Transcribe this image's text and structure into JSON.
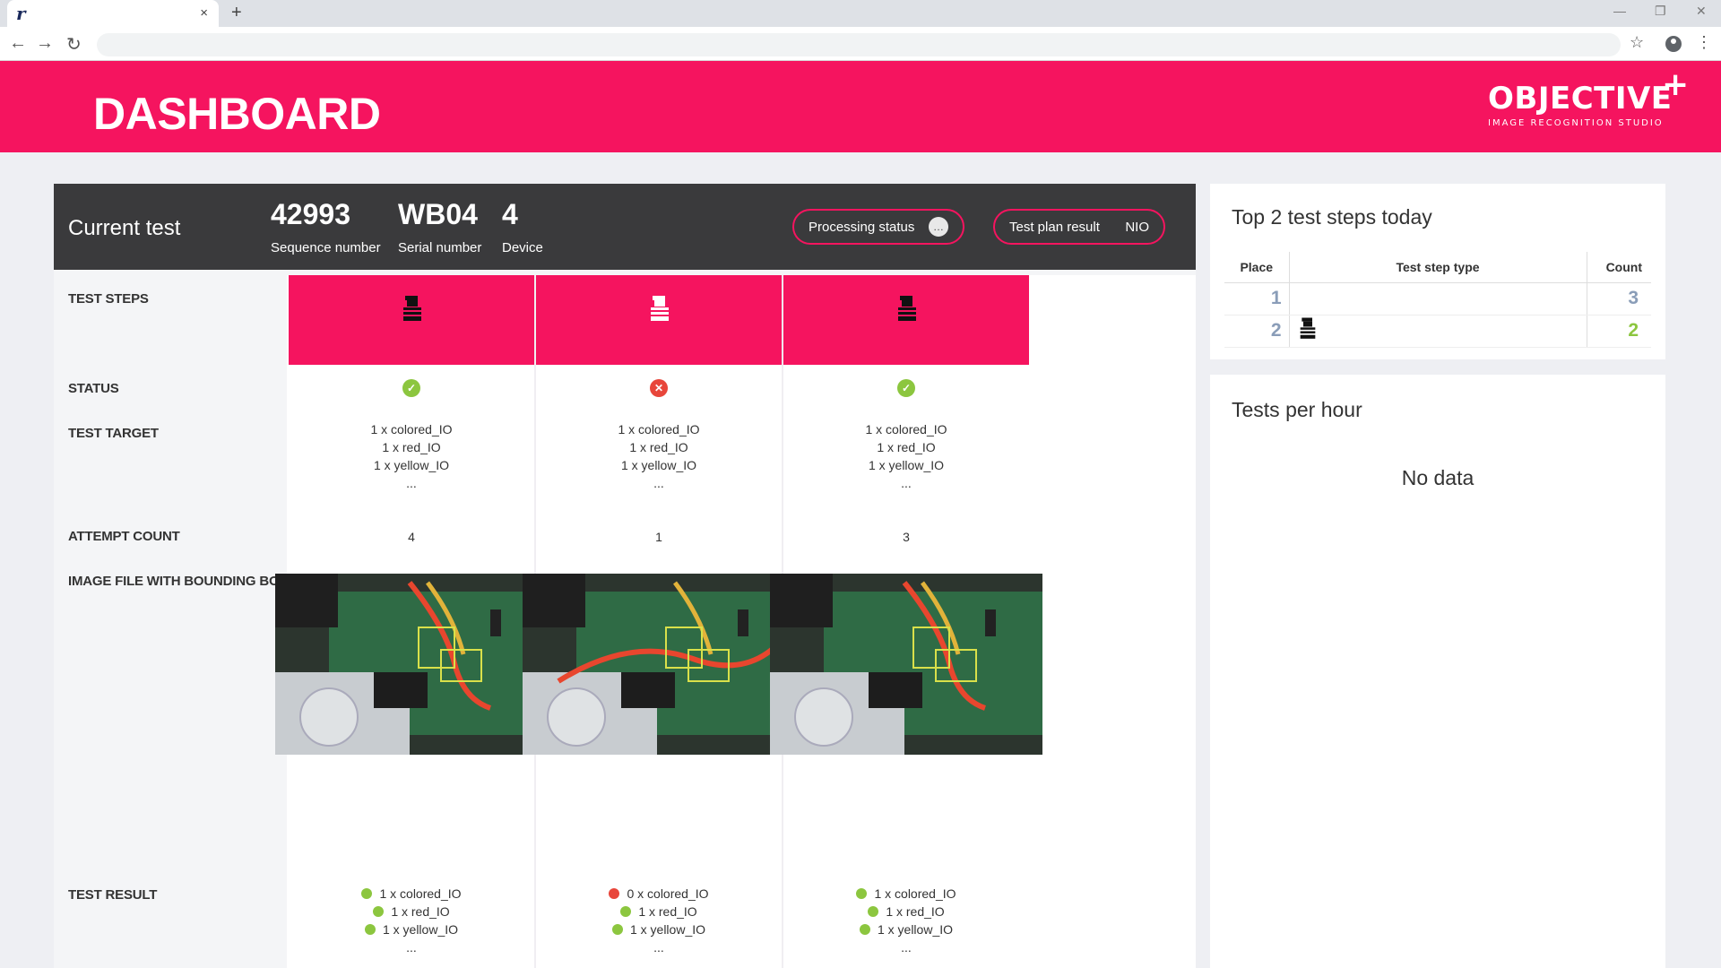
{
  "browser": {
    "tab_logo": "r",
    "tab_close": "×",
    "new_tab": "+",
    "back": "←",
    "forward": "→",
    "reload": "↻",
    "bookmark": "☆",
    "menu": "⋮",
    "minimize": "—",
    "restore": "❐",
    "close": "✕"
  },
  "header": {
    "title": "DASHBOARD",
    "brand_name": "OBJECTIVE",
    "brand_plus": "+",
    "brand_sub": "IMAGE RECOGNITION STUDIO",
    "accent_color": "#f5145f"
  },
  "current_test": {
    "label": "Current test",
    "sequence_number": "42993",
    "sequence_label": "Sequence number",
    "serial_number": "WB04",
    "serial_label": "Serial number",
    "device": "4",
    "device_label": "Device",
    "processing_status_label": "Processing status",
    "processing_status_icon": "…",
    "test_plan_result_label": "Test plan result",
    "test_plan_result_value": "NIO"
  },
  "row_labels": {
    "test_steps": "TEST STEPS",
    "status": "STATUS",
    "test_target": "TEST TARGET",
    "attempt_count": "ATTEMPT COUNT",
    "image_file": "IMAGE FILE WITH BOUNDING BOX",
    "test_result": "TEST RESULT"
  },
  "steps": [
    {
      "icon": "cable-connector-icon",
      "status": "ok",
      "status_glyph": "✓",
      "target": [
        "1 x colored_IO",
        "1 x red_IO",
        "1 x yellow_IO",
        "..."
      ],
      "attempt_count": "4",
      "image": "motherboard-photo",
      "result": [
        {
          "text": "1 x colored_IO",
          "status": "ok"
        },
        {
          "text": "1 x red_IO",
          "status": "ok"
        },
        {
          "text": "1 x yellow_IO",
          "status": "ok"
        },
        {
          "text": "..."
        }
      ]
    },
    {
      "icon": "cable-connector-icon",
      "status": "fail",
      "status_glyph": "✕",
      "target": [
        "1 x colored_IO",
        "1 x red_IO",
        "1 x yellow_IO",
        "..."
      ],
      "attempt_count": "1",
      "image": "motherboard-photo",
      "result": [
        {
          "text": "0 x colored_IO",
          "status": "fail"
        },
        {
          "text": "1 x red_IO",
          "status": "ok"
        },
        {
          "text": "1 x yellow_IO",
          "status": "ok"
        },
        {
          "text": "..."
        }
      ]
    },
    {
      "icon": "cable-connector-icon",
      "status": "ok",
      "status_glyph": "✓",
      "target": [
        "1 x colored_IO",
        "1 x red_IO",
        "1 x yellow_IO",
        "..."
      ],
      "attempt_count": "3",
      "image": "motherboard-photo",
      "result": [
        {
          "text": "1 x colored_IO",
          "status": "ok"
        },
        {
          "text": "1 x red_IO",
          "status": "ok"
        },
        {
          "text": "1 x yellow_IO",
          "status": "ok"
        },
        {
          "text": "..."
        }
      ]
    }
  ],
  "top_steps": {
    "title": "Top 2 test steps today",
    "headers": [
      "Place",
      "Test step type",
      "Count"
    ],
    "rows": [
      {
        "place": "1",
        "count": "3",
        "count_color": "#8a9db8"
      },
      {
        "place": "2",
        "icon": "cable-connector-icon",
        "count": "2",
        "count_color": "#8cc63f"
      }
    ]
  },
  "tests_per_hour": {
    "title": "Tests per hour",
    "empty": "No data"
  },
  "colors": {
    "ok": "#8cc63f",
    "fail": "#e8463b",
    "header_dark": "#3a3a3c"
  }
}
